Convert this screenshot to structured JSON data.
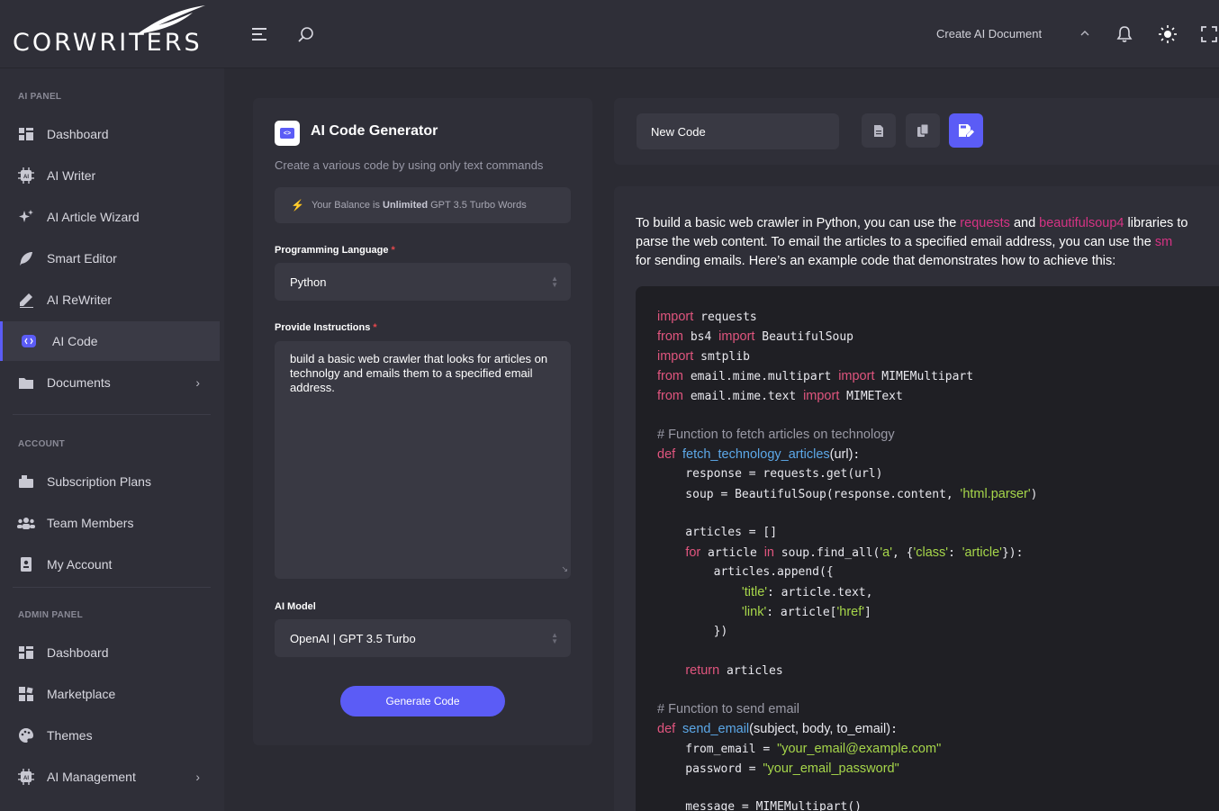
{
  "brand": {
    "logo_text": "CORWRITERS"
  },
  "topbar": {
    "create_label": "Create AI Document"
  },
  "sidebar": {
    "sections": {
      "ai_panel": "AI PANEL",
      "account": "ACCOUNT",
      "admin_panel": "ADMIN PANEL"
    },
    "ai_items": [
      {
        "label": "Dashboard",
        "icon": "dashboard-icon"
      },
      {
        "label": "AI Writer",
        "icon": "ai-chip-icon"
      },
      {
        "label": "AI Article Wizard",
        "icon": "sparkles-icon"
      },
      {
        "label": "Smart Editor",
        "icon": "feather-icon"
      },
      {
        "label": "AI ReWriter",
        "icon": "pencil-icon"
      },
      {
        "label": "AI Code",
        "icon": "code-icon",
        "active": true
      },
      {
        "label": "Documents",
        "icon": "folder-icon"
      }
    ],
    "account_items": [
      {
        "label": "Subscription Plans",
        "icon": "box-icon"
      },
      {
        "label": "Team Members",
        "icon": "team-icon"
      },
      {
        "label": "My Account",
        "icon": "id-card-icon"
      }
    ],
    "admin_items": [
      {
        "label": "Dashboard",
        "icon": "dashboard-icon"
      },
      {
        "label": "Marketplace",
        "icon": "grid-icon"
      },
      {
        "label": "Themes",
        "icon": "palette-icon"
      },
      {
        "label": "AI Management",
        "icon": "ai-chip-icon"
      }
    ]
  },
  "form": {
    "title": "AI Code Generator",
    "subtitle": "Create a various code by using only text commands",
    "balance_prefix": "Your Balance is",
    "balance_bold": "Unlimited",
    "balance_suffix": "GPT 3.5 Turbo Words",
    "language_label": "Programming Language",
    "language_value": "Python",
    "instructions_label": "Provide Instructions",
    "instructions_value": "build a basic web crawler that looks for articles on technolgy and emails them to a specified email address.",
    "model_label": "AI Model",
    "model_value": "OpenAI | GPT 3.5 Turbo",
    "generate_label": "Generate Code",
    "required_mark": "*"
  },
  "output": {
    "doc_name": "New Code",
    "intro_1a": "To build a basic web crawler in Python, you can use the ",
    "intro_pk1": "requests",
    "intro_1b": " and ",
    "intro_pk2": "beautifulsoup4",
    "intro_1c": " libraries to",
    "intro_2a": "parse the web content. To email the articles to a specified email address, you can use the ",
    "intro_pk3": "sm",
    "intro_3": "for sending emails. Here’s an example code that demonstrates how to achieve this:"
  },
  "colors": {
    "accent": "#5b5cf6",
    "keyword": "#e0557e",
    "string": "#a6d64a",
    "function": "#5ca8e8"
  }
}
